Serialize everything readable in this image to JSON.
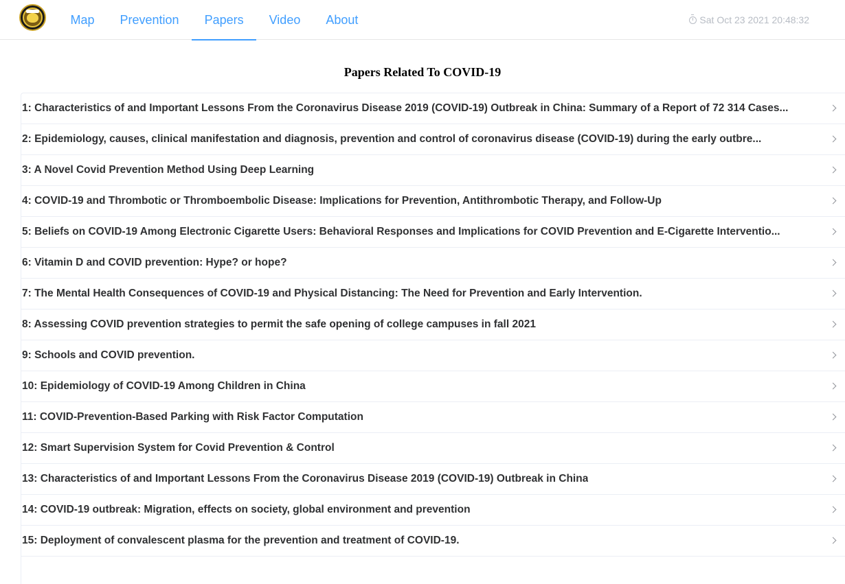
{
  "nav": {
    "logo_icon": "university-emblem-icon",
    "items": [
      {
        "label": "Map",
        "active": false
      },
      {
        "label": "Prevention",
        "active": false
      },
      {
        "label": "Papers",
        "active": true
      },
      {
        "label": "Video",
        "active": false
      },
      {
        "label": "About",
        "active": false
      }
    ],
    "accent_color": "#409eff"
  },
  "clock": {
    "icon": "clock-icon",
    "text": "Sat Oct 23 2021 20:48:32"
  },
  "page": {
    "title": "Papers Related To COVID-19"
  },
  "papers": [
    {
      "title": "1: Characteristics of and Important Lessons From the Coronavirus Disease 2019 (COVID-19) Outbreak in China: Summary of a Report of 72 314 Cases..."
    },
    {
      "title": "2: Epidemiology, causes, clinical manifestation and diagnosis, prevention and control of coronavirus disease (COVID-19) during the early outbre..."
    },
    {
      "title": "3: A Novel Covid Prevention Method Using Deep Learning"
    },
    {
      "title": "4: COVID-19 and Thrombotic or Thromboembolic Disease: Implications for Prevention, Antithrombotic Therapy, and Follow-Up"
    },
    {
      "title": "5: Beliefs on COVID-19 Among Electronic Cigarette Users: Behavioral Responses and Implications for COVID Prevention and E-Cigarette Interventio..."
    },
    {
      "title": "6: Vitamin D and COVID prevention: Hype? or hope?"
    },
    {
      "title": "7: The Mental Health Consequences of COVID-19 and Physical Distancing: The Need for Prevention and Early Intervention."
    },
    {
      "title": "8: Assessing COVID prevention strategies to permit the safe opening of college campuses in fall 2021"
    },
    {
      "title": "9: Schools and COVID prevention."
    },
    {
      "title": "10: Epidemiology of COVID-19 Among Children in China"
    },
    {
      "title": "11: COVID-Prevention-Based Parking with Risk Factor Computation"
    },
    {
      "title": "12: Smart Supervision System for Covid Prevention & Control"
    },
    {
      "title": "13: Characteristics of and Important Lessons From the Coronavirus Disease 2019 (COVID-19) Outbreak in China"
    },
    {
      "title": "14: COVID-19 outbreak: Migration, effects on society, global environment and prevention"
    },
    {
      "title": "15: Deployment of convalescent plasma for the prevention and treatment of COVID-19."
    }
  ],
  "row_arrow_icon": "chevron-right-icon"
}
